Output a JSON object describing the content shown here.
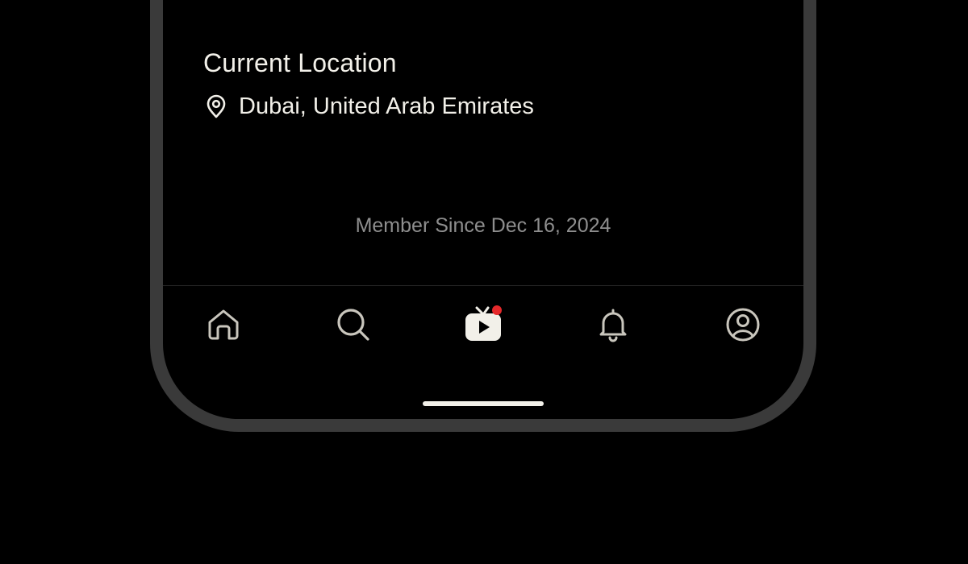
{
  "profile": {
    "location_title": "Current Location",
    "location_icon": "map-pin-icon",
    "location_value": "Dubai, United Arab Emirates",
    "member_since": "Member Since Dec 16, 2024"
  },
  "tabbar": {
    "items": [
      {
        "id": "home",
        "icon": "home-icon",
        "active": false
      },
      {
        "id": "search",
        "icon": "search-icon",
        "active": false
      },
      {
        "id": "live",
        "icon": "live-tv-icon",
        "active": true,
        "badge": true
      },
      {
        "id": "notifications",
        "icon": "bell-icon",
        "active": false
      },
      {
        "id": "profile",
        "icon": "user-circle-icon",
        "active": false
      }
    ]
  },
  "colors": {
    "background": "#000000",
    "frame": "#3a3a3a",
    "text_primary": "#f2f0e9",
    "text_muted": "#8e8e8e",
    "icon_inactive": "#c9c6bd",
    "badge": "#e5292b"
  }
}
